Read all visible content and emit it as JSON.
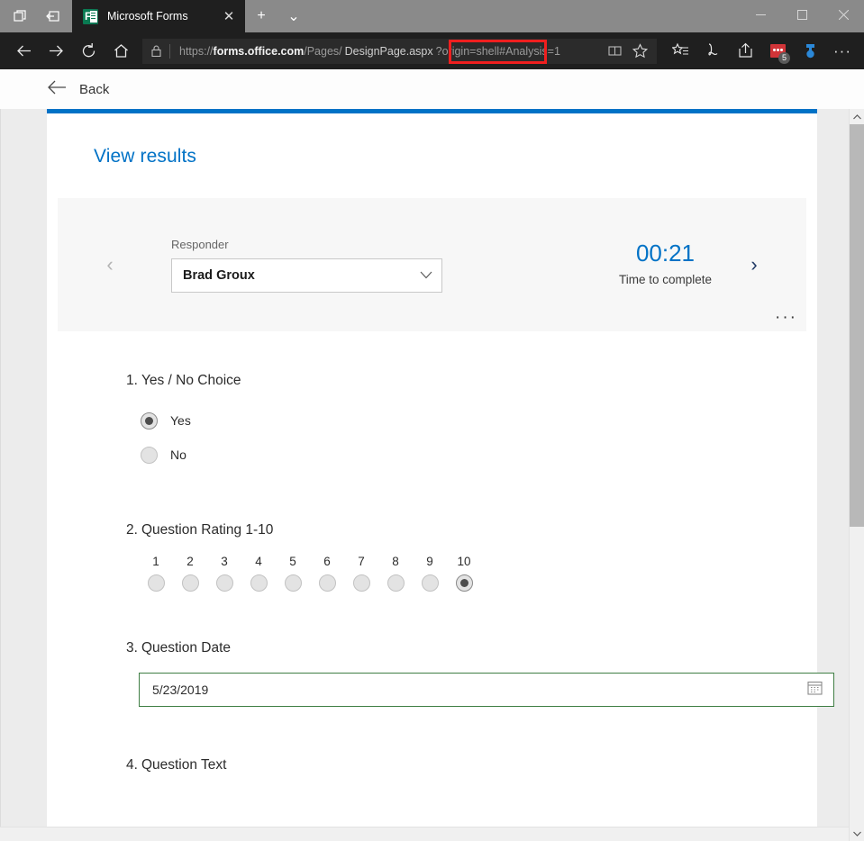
{
  "browser": {
    "window_controls": {
      "minimize": "—",
      "maximize": "☐",
      "close": "✕"
    },
    "system_buttons": [
      {
        "name": "tab-preview-icon",
        "glyph": "⧉"
      },
      {
        "name": "set-tabs-aside-icon",
        "glyph": "⇤"
      }
    ],
    "tab": {
      "title": "Microsoft Forms",
      "close_glyph": "✕",
      "favicon_letter": "F"
    },
    "new_tab_glyph": "+",
    "tab_menu_glyph": "⌄",
    "nav": {
      "back_glyph": "←",
      "forward_glyph": "→",
      "refresh_glyph": "↻",
      "home_glyph": "⌂"
    },
    "address": {
      "lock_glyph": "ὑ2",
      "scheme": "https://",
      "host": "forms.office.com",
      "path_before": "/Pages/",
      "highlighted": "DesignPage.aspx",
      "path_after": "?origin=shell#Analysis=1",
      "full_url": "https://forms.office.com/Pages/DesignPage.aspx?origin=shell#Analysis=1",
      "highlight_color": "#ef1f1f",
      "reading_view_glyph": "▤",
      "favorite_glyph": "☆"
    },
    "toolbar_icons": [
      {
        "name": "favorites-hub-icon",
        "glyph": "★"
      },
      {
        "name": "web-notes-icon",
        "glyph": "✎"
      },
      {
        "name": "share-icon",
        "glyph": "↪"
      },
      {
        "name": "extension-red-icon",
        "badge": "5"
      },
      {
        "name": "extension-blue-icon",
        "glyph": "☣"
      },
      {
        "name": "settings-more-icon",
        "glyph": "···"
      }
    ]
  },
  "page": {
    "back_label": "Back",
    "back_arrow_glyph": "←",
    "heading": "View results",
    "accent_color": "#0072c6",
    "responder": {
      "label": "Responder",
      "selected_name": "Brad Groux",
      "caret_glyph": "⌄",
      "prev_glyph": "‹",
      "next_glyph": "›",
      "time_value": "00:21",
      "time_label": "Time to complete",
      "more_glyph": "···"
    },
    "questions": [
      {
        "number": "1.",
        "title": "Yes / No Choice",
        "type": "choice",
        "options": [
          {
            "label": "Yes",
            "selected": true
          },
          {
            "label": "No",
            "selected": false
          }
        ]
      },
      {
        "number": "2.",
        "title": "Question Rating 1-10",
        "type": "rating",
        "scale": [
          "1",
          "2",
          "3",
          "4",
          "5",
          "6",
          "7",
          "8",
          "9",
          "10"
        ],
        "selected_value": "10"
      },
      {
        "number": "3.",
        "title": "Question Date",
        "type": "date",
        "value": "5/23/2019",
        "calendar_glyph": "Ὄ5",
        "border_color": "#3f7e44"
      },
      {
        "number": "4.",
        "title": "Question Text",
        "type": "text"
      }
    ]
  },
  "scrollbar": {
    "up_glyph": "▲",
    "down_glyph": "▼"
  }
}
